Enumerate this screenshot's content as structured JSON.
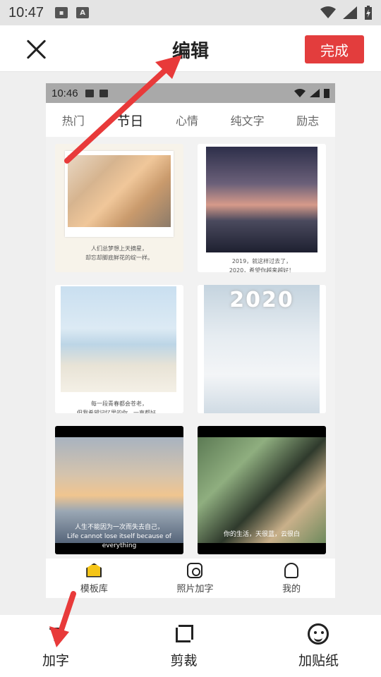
{
  "system_status": {
    "time": "10:47"
  },
  "header": {
    "title": "编辑",
    "done_label": "完成"
  },
  "preview": {
    "status_time": "10:46",
    "tabs": [
      "热门",
      "节日",
      "心情",
      "纯文字",
      "励志"
    ],
    "cards": [
      {
        "caption": "人们总梦想上天摘星，\n却忘却脚底鲜花的绽一样。"
      },
      {
        "caption": "2019，就这样过去了，\n2020，希望你越来越好！"
      },
      {
        "caption": "每一段青春都会苍老，\n但我希望记忆里的你，一直都好。"
      },
      {
        "overlay": "2020"
      },
      {
        "caption": "人生不能因为一次而失去自己，\nLife cannot lose itself because of everything"
      },
      {
        "caption": "你的生活，天很蓝，云很白"
      }
    ],
    "bottom_nav": [
      "模板库",
      "照片加字",
      "我的"
    ]
  },
  "toolbar": {
    "items": [
      "加字",
      "剪裁",
      "加贴纸"
    ]
  },
  "colors": {
    "accent": "#e33d3d",
    "annotation": "#e83a3a"
  }
}
